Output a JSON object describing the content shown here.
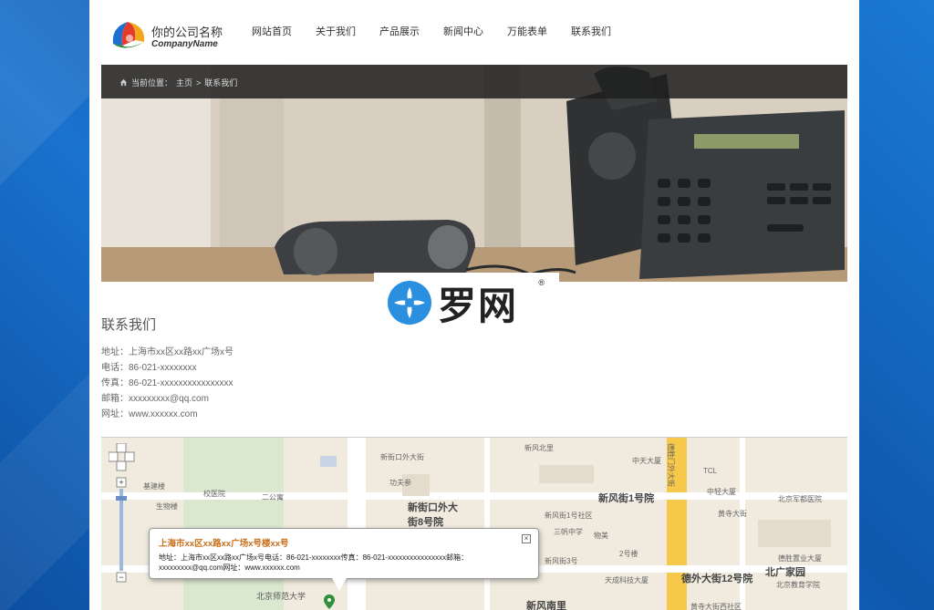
{
  "header": {
    "company_name": "你的公司名称",
    "company_sub": "CompanyName",
    "nav": [
      "网站首页",
      "关于我们",
      "产品展示",
      "新闻中心",
      "万能表单",
      "联系我们"
    ]
  },
  "banner": {
    "breadcrumb_prefix": "当前位置：",
    "breadcrumb_home": "主页",
    "breadcrumb_sep": ">",
    "breadcrumb_current": "联系我们"
  },
  "watermark": {
    "text": "罗网",
    "reg": "®"
  },
  "contact": {
    "title": "联系我们",
    "address": "地址：上海市xx区xx路xx广场x号",
    "phone": "电话：86-021-xxxxxxxx",
    "fax": "传真：86-021-xxxxxxxxxxxxxxxx",
    "email": "邮箱：xxxxxxxxx@qq.com",
    "website": "网址：www.xxxxxx.com"
  },
  "map": {
    "popup_title": "上海市xx区xx路xx广场x号楼xx号",
    "popup_line1": "地址：上海市xx区xx路xx广场x号电话：86-021-xxxxxxxx传真：86-021-xxxxxxxxxxxxxxxx邮箱：",
    "popup_line2": "xxxxxxxxx@qq.com网址：www.xxxxxx.com",
    "labels": [
      {
        "text": "新街口外大街8号院",
        "big": true
      },
      {
        "text": "新风街1号院",
        "big": true
      },
      {
        "text": "德外大街12号院",
        "big": true
      },
      {
        "text": "北广家园",
        "big": true
      },
      {
        "text": "新风南里",
        "big": true
      },
      {
        "text": "北京师范大学"
      },
      {
        "text": "功夫参"
      },
      {
        "text": "新风北里"
      },
      {
        "text": "中天大厦"
      },
      {
        "text": "黄寺大街"
      },
      {
        "text": "北京军都医院"
      },
      {
        "text": "德胜置业大厦"
      },
      {
        "text": "北京教育学院"
      },
      {
        "text": "天成科技大厦"
      },
      {
        "text": "基建楼"
      },
      {
        "text": "生物楼"
      },
      {
        "text": "校医院"
      },
      {
        "text": "二公寓"
      },
      {
        "text": "新街口外大街"
      },
      {
        "text": "德胜门外大街"
      },
      {
        "text": "TCL"
      },
      {
        "text": "中轻大厦"
      },
      {
        "text": "新风街1号社区"
      },
      {
        "text": "三帆中学"
      },
      {
        "text": "物美"
      },
      {
        "text": "新风街3号"
      },
      {
        "text": "2号楼"
      },
      {
        "text": "黄寺大街西社区"
      },
      {
        "text": "北京教育学院"
      }
    ]
  }
}
